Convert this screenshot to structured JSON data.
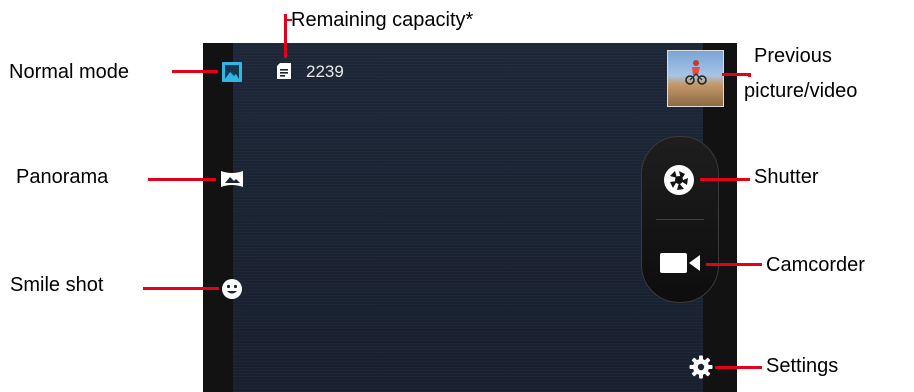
{
  "labels": {
    "remaining_capacity": "Remaining capacity*",
    "normal_mode": "Normal mode",
    "panorama": "Panorama",
    "smile_shot": "Smile shot",
    "previous_line1": "Previous",
    "previous_line2": "picture/video",
    "shutter": "Shutter",
    "camcorder": "Camcorder",
    "settings": "Settings"
  },
  "camera": {
    "remaining_count": "2239"
  },
  "colors": {
    "callout": "#e3001b",
    "active_mode": "#33b5e5",
    "icon": "#ffffff"
  },
  "icons": {
    "normal_mode": "image-icon",
    "panorama": "panorama-icon",
    "smile_shot": "smile-icon",
    "storage": "sd-card-icon",
    "shutter": "aperture-icon",
    "camcorder": "video-camera-icon",
    "settings": "gear-icon"
  }
}
